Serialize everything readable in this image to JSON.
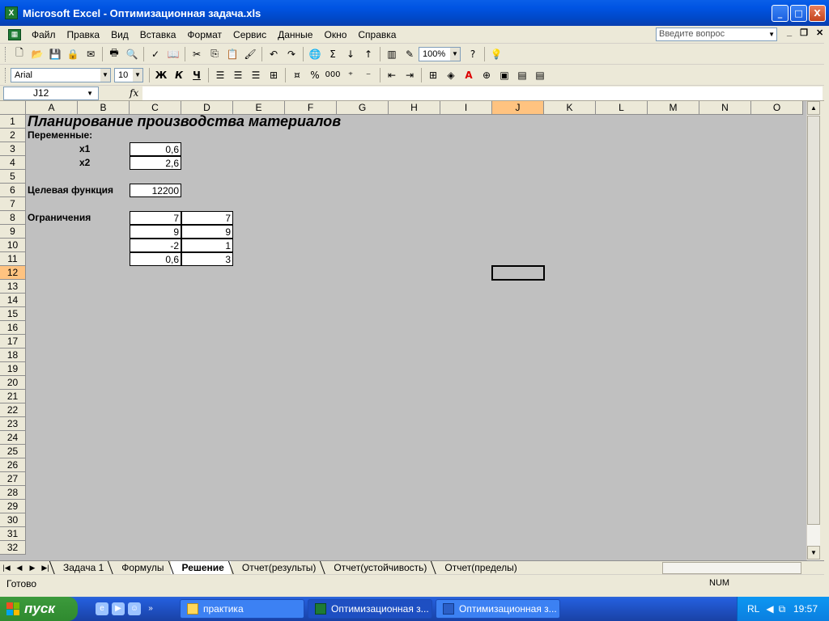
{
  "window": {
    "title": "Microsoft Excel - Оптимизационная задача.xls",
    "app_icon_text": "X",
    "min_label": "_",
    "max_label": "□",
    "close_label": "X"
  },
  "menu": {
    "items": [
      "Файл",
      "Правка",
      "Вид",
      "Вставка",
      "Формат",
      "Сервис",
      "Данные",
      "Окно",
      "Справка"
    ],
    "ask_placeholder": "Введите вопрос"
  },
  "toolbar": {
    "zoom": "100%",
    "font_name": "Arial",
    "font_size": "10",
    "bold_label": "Ж",
    "italic_label": "К",
    "underline_label": "Ч",
    "percent_label": "%",
    "thousands_label": "000"
  },
  "formula_bar": {
    "name_box": "J12",
    "fx_label": "fx",
    "formula": ""
  },
  "grid": {
    "columns": [
      "A",
      "B",
      "C",
      "D",
      "E",
      "F",
      "G",
      "H",
      "I",
      "J",
      "K",
      "L",
      "M",
      "N",
      "O"
    ],
    "rows": [
      "1",
      "2",
      "3",
      "4",
      "5",
      "6",
      "7",
      "8",
      "9",
      "10",
      "11",
      "12",
      "13",
      "14",
      "15",
      "16",
      "17",
      "18",
      "19",
      "20",
      "21",
      "22",
      "23",
      "24",
      "25",
      "26",
      "27",
      "28",
      "29",
      "30",
      "31",
      "32"
    ],
    "active_column": "J",
    "active_row": "12"
  },
  "sheet": {
    "title": "Планирование производства материалов",
    "variables_label": "Переменные:",
    "x1_label": "x1",
    "x1_value": "0,6",
    "x2_label": "x2",
    "x2_value": "2,6",
    "objective_label": "Целевая функция",
    "objective_value": "12200",
    "constraints_label": "Ограничения",
    "constraints": [
      {
        "c": "7",
        "d": "7"
      },
      {
        "c": "9",
        "d": "9"
      },
      {
        "c": "-2",
        "d": "1"
      },
      {
        "c": "0,6",
        "d": "3"
      }
    ]
  },
  "tabs": [
    {
      "label": "Задача 1",
      "active": false
    },
    {
      "label": "Формулы",
      "active": false
    },
    {
      "label": "Решение",
      "active": true
    },
    {
      "label": "Отчет(результы)",
      "active": false
    },
    {
      "label": "Отчет(устойчивость)",
      "active": false
    },
    {
      "label": "Отчет(пределы)",
      "active": false
    }
  ],
  "status": {
    "ready": "Готово",
    "num": "NUM"
  },
  "taskbar": {
    "start": "пуск",
    "tasks": [
      {
        "label": "практика",
        "active": false
      },
      {
        "label": "Оптимизационная з...",
        "active": true
      },
      {
        "label": "Оптимизационная з...",
        "active": false
      }
    ],
    "lang": "RL",
    "clock": "19:57"
  }
}
